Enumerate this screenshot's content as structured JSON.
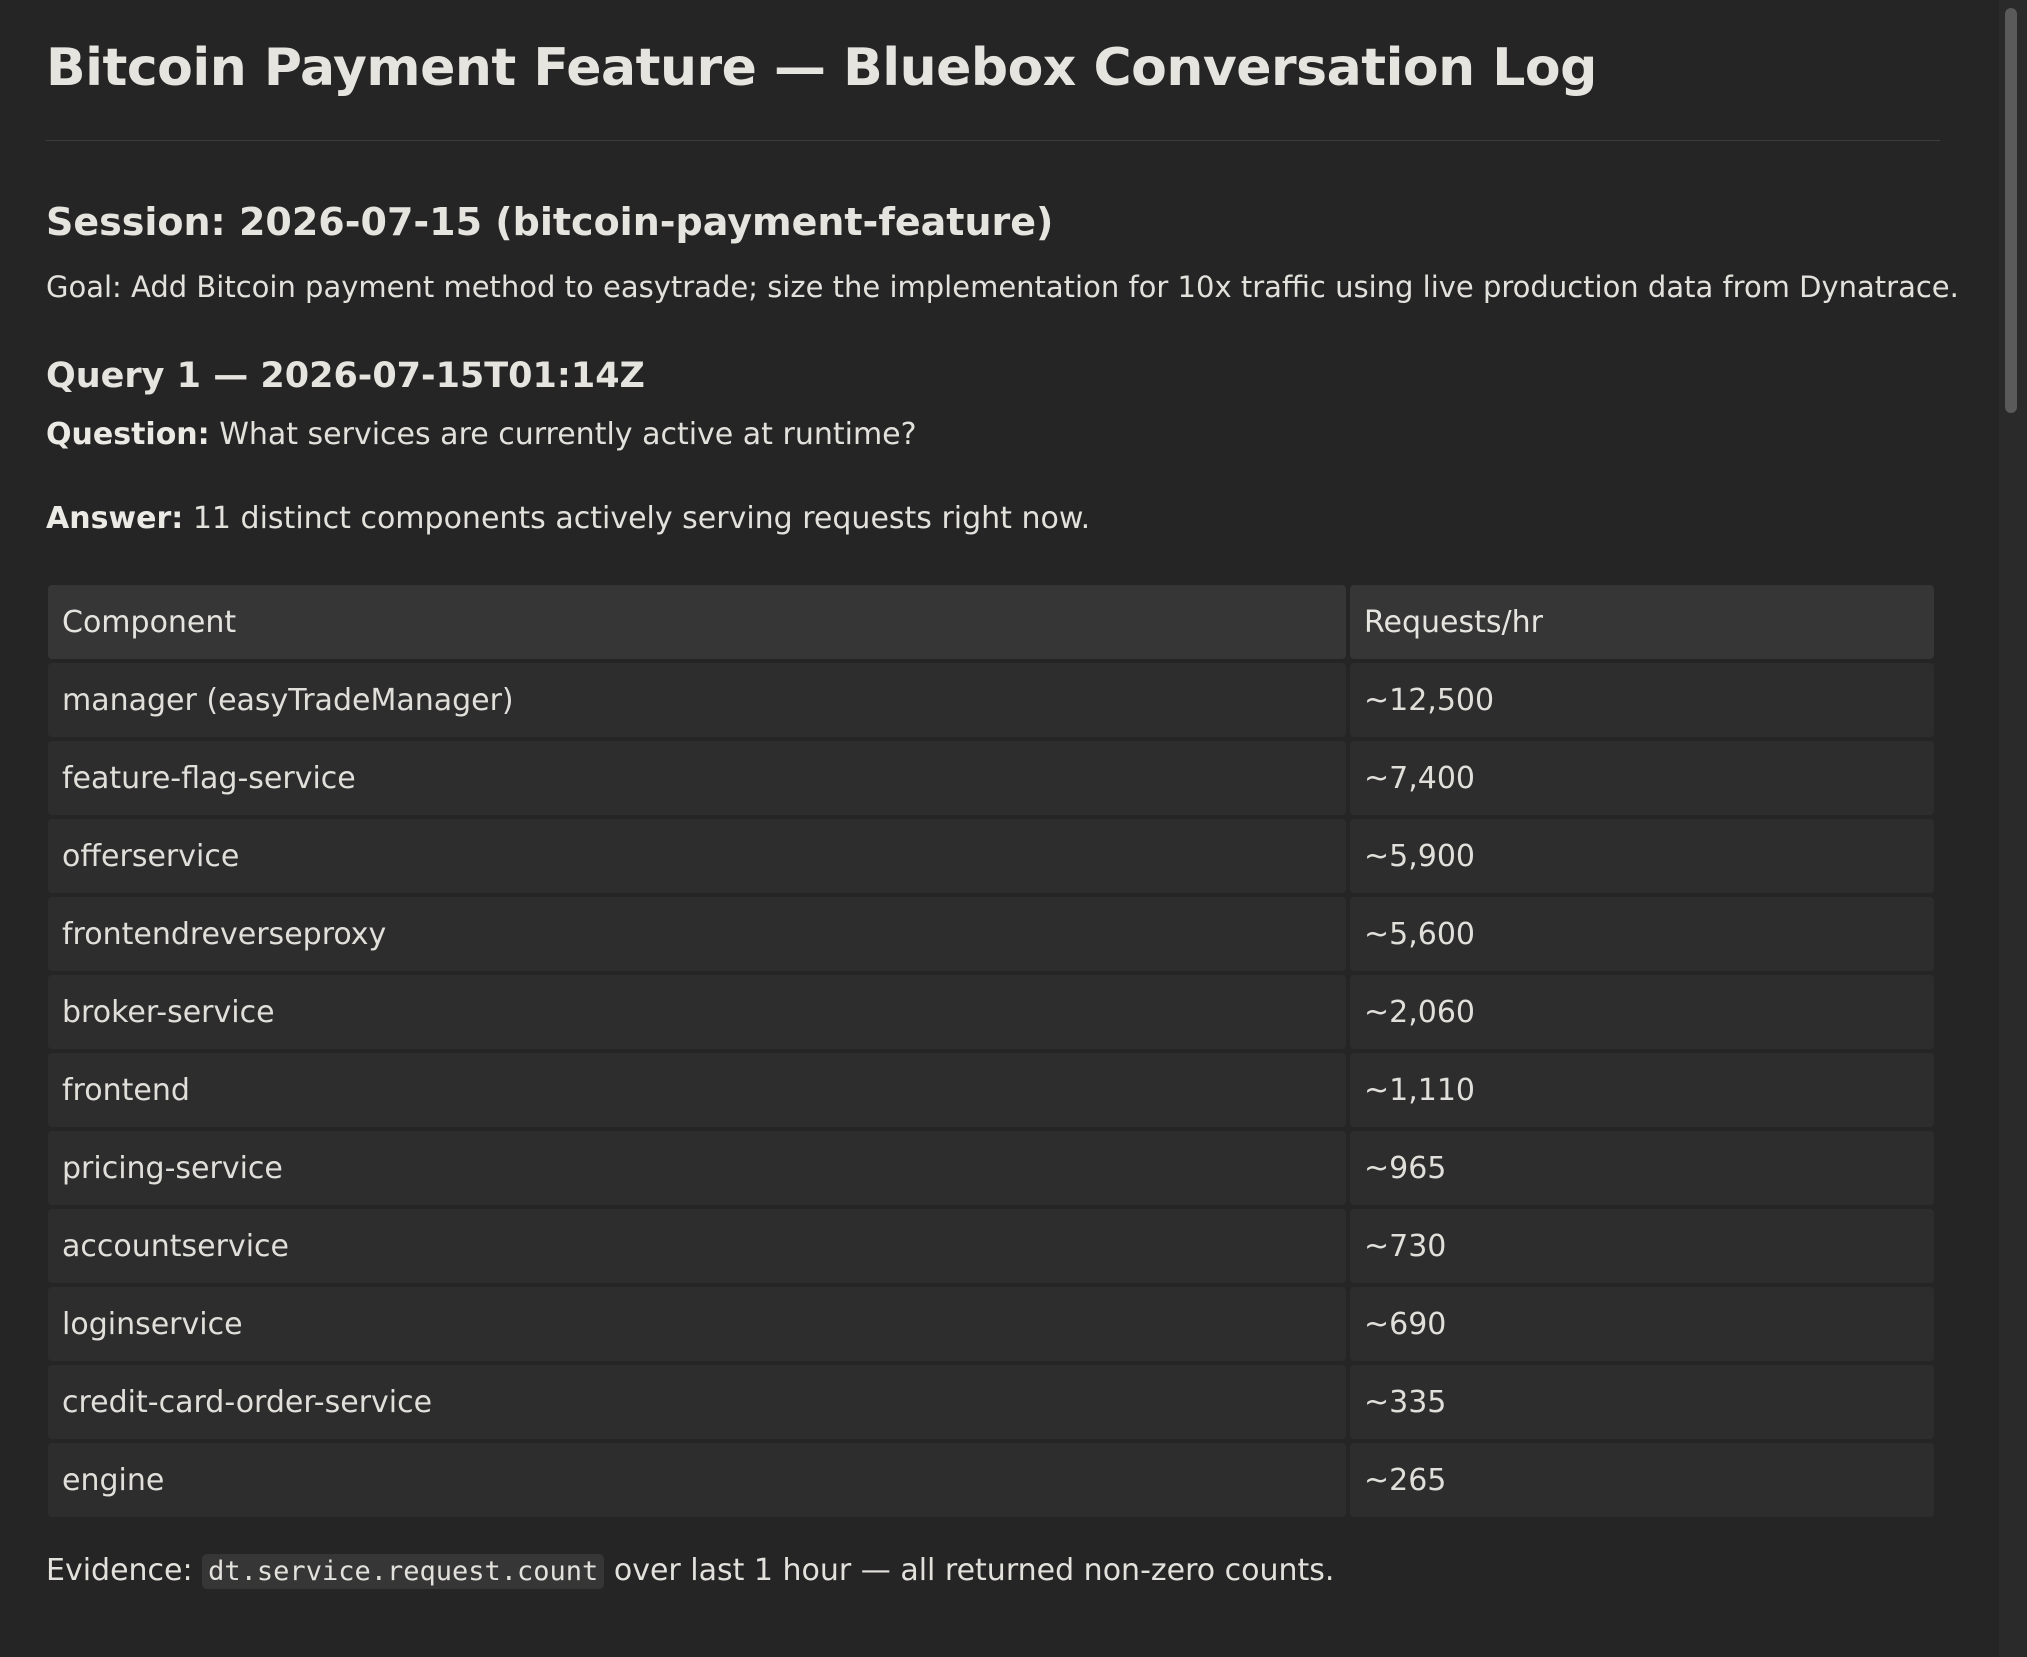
{
  "title": "Bitcoin Payment Feature — Bluebox Conversation Log",
  "session": {
    "heading": "Session: 2026-07-15 (bitcoin-payment-feature)",
    "goal": "Goal: Add Bitcoin payment method to easytrade; size the implementation for 10x traffic using live production data from Dynatrace."
  },
  "query": {
    "heading": "Query 1 — 2026-07-15T01:14Z",
    "question_label": "Question:",
    "question_text": " What services are currently active at runtime?",
    "answer_label": "Answer:",
    "answer_text": " 11 distinct components actively serving requests right now."
  },
  "table": {
    "headers": [
      "Component",
      "Requests/hr"
    ],
    "rows": [
      [
        "manager (easyTradeManager)",
        "~12,500"
      ],
      [
        "feature-flag-service",
        "~7,400"
      ],
      [
        "offerservice",
        "~5,900"
      ],
      [
        "frontendreverseproxy",
        "~5,600"
      ],
      [
        "broker-service",
        "~2,060"
      ],
      [
        "frontend",
        "~1,110"
      ],
      [
        "pricing-service",
        "~965"
      ],
      [
        "accountservice",
        "~730"
      ],
      [
        "loginservice",
        "~690"
      ],
      [
        "credit-card-order-service",
        "~335"
      ],
      [
        "engine",
        "~265"
      ]
    ]
  },
  "evidence": {
    "prefix": "Evidence: ",
    "code": "dt.service.request.count",
    "suffix": " over last 1 hour — all returned non-zero counts."
  },
  "colors": {
    "background": "#252525",
    "text": "#e3e1dc",
    "header_cell": "#363636",
    "body_cell": "#2d2d2d"
  }
}
